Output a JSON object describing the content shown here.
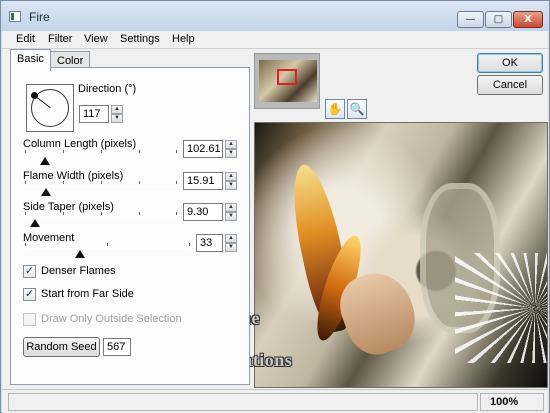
{
  "window": {
    "title": "Fire",
    "controls": {
      "minimize": "—",
      "maximize": "□",
      "close": "X"
    }
  },
  "menu": [
    "Edit",
    "Filter",
    "View",
    "Settings",
    "Help"
  ],
  "tabs": {
    "basic": "Basic",
    "color": "Color"
  },
  "direction": {
    "label": "Direction (°)",
    "value": "117"
  },
  "column_length": {
    "label": "Column Length (pixels)",
    "value": "102.61",
    "slider_fraction": 0.13
  },
  "flame_width": {
    "label": "Flame Width (pixels)",
    "value": "15.91",
    "slider_fraction": 0.13
  },
  "side_taper": {
    "label": "Side Taper (pixels)",
    "value": "9.30",
    "slider_fraction": 0.07
  },
  "movement": {
    "label": "Movement",
    "value": "33",
    "slider_fraction": 0.33
  },
  "checkboxes": {
    "denser_flames": {
      "label": "Denser Flames",
      "checked": true
    },
    "start_far_side": {
      "label": "Start from Far Side",
      "checked": true
    },
    "draw_outside": {
      "label": "Draw Only Outside Selection",
      "checked": false,
      "disabled": true
    }
  },
  "random_seed": {
    "button_label": "Random Seed",
    "value": "567"
  },
  "buttons": {
    "ok": "OK",
    "cancel": "Cancel"
  },
  "tools": {
    "pan": "pan-icon",
    "zoom": "magnifier-icon"
  },
  "watermark": {
    "line1": "Faline",
    "line2": "Dreamcreations"
  },
  "status": {
    "zoom": "100%"
  }
}
